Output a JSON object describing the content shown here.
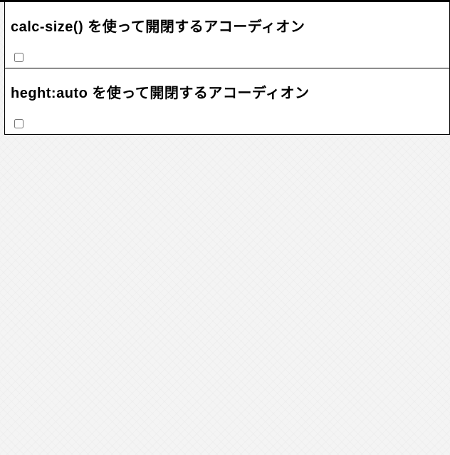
{
  "accordions": [
    {
      "title": "calc-size() を使って開閉するアコーディオン",
      "checked": false
    },
    {
      "title": "heght:auto を使って開閉するアコーディオン",
      "checked": false
    }
  ]
}
